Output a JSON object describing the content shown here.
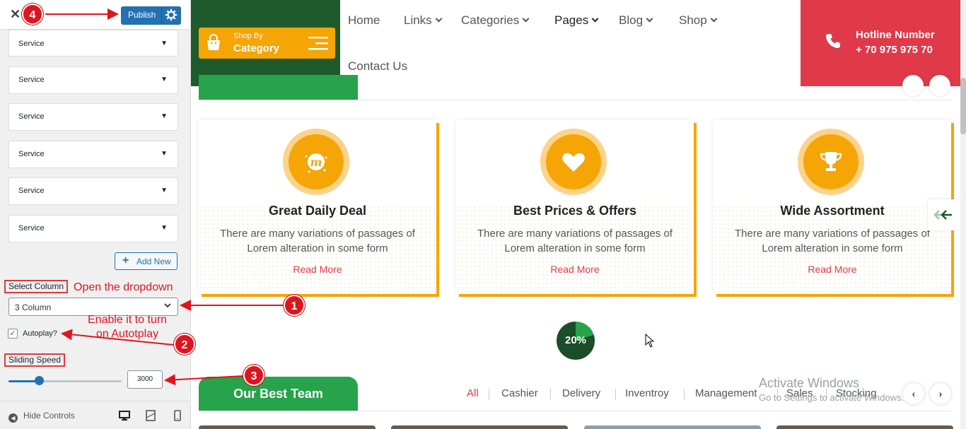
{
  "customizer": {
    "close_label": "✕",
    "publish_label": "Publish",
    "service_items": [
      "Service",
      "Service",
      "Service",
      "Service",
      "Service",
      "Service"
    ],
    "add_new_label": "Add New",
    "select_column": {
      "label": "Select Column",
      "value": "3 Column"
    },
    "autoplay": {
      "label": "Autoplay?",
      "checked": true
    },
    "sliding_speed": {
      "label": "Sliding Speed",
      "value": "3000",
      "level_fraction": 0.27
    },
    "footer": {
      "hide_controls_label": "Hide Controls"
    }
  },
  "annotations": {
    "step1": {
      "num": "1",
      "text": "Open the dropdown"
    },
    "step2": {
      "num": "2",
      "text_line1": "Enable it to turn",
      "text_line2": "on Autotplay"
    },
    "step3": {
      "num": "3"
    },
    "step4": {
      "num": "4"
    }
  },
  "site": {
    "shop_button": {
      "line1": "Shop By",
      "line2": "Category"
    },
    "nav": [
      "Home",
      "Links",
      "Categories",
      "Pages",
      "Blog",
      "Shop",
      "Contact Us"
    ],
    "hotline": {
      "label": "Hotline Number",
      "number": "+ 70 975 975 70"
    },
    "services": [
      {
        "icon": "meetup-m-icon",
        "title": "Great Daily Deal",
        "desc": "There are many variations of passages of Lorem alteration in some form",
        "link": "Read More"
      },
      {
        "icon": "heart-icon",
        "title": "Best Prices & Offers",
        "desc": "There are many variations of passages of Lorem alteration in some form",
        "link": "Read More"
      },
      {
        "icon": "trophy-icon",
        "title": "Wide Assortment",
        "desc": "There are many variations of passages of Lorem alteration in some form",
        "link": "Read More"
      }
    ],
    "progress": {
      "label": "20%",
      "value": 20
    },
    "team": {
      "title": "Our Best Team",
      "filters": [
        "All",
        "Cashier",
        "Delivery",
        "Inventroy",
        "Management",
        "Sales",
        "Stocking"
      ]
    },
    "watermark": {
      "line1": "Activate Windows",
      "line2": "Go to Settings to activate Windows."
    }
  },
  "colors": {
    "dark_green": "#1f5a2d",
    "green": "#27a34b",
    "orange": "#f5a506",
    "red": "#e0394a",
    "wp_blue": "#2271b1"
  }
}
